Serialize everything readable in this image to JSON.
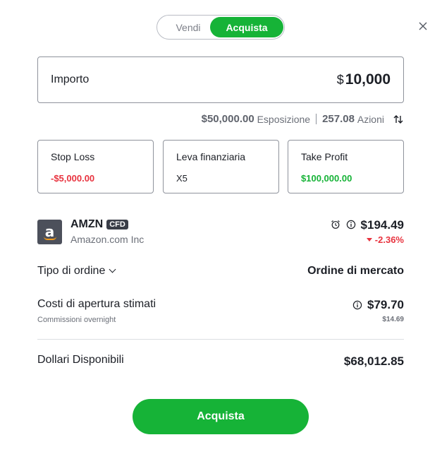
{
  "toggle": {
    "sell_label": "Vendi",
    "buy_label": "Acquista",
    "active": "buy"
  },
  "amount": {
    "label": "Importo",
    "currency": "$",
    "value": "10,000"
  },
  "exposure": {
    "value": "$50,000.00",
    "label": "Esposizione",
    "units_value": "257.08",
    "units_label": "Azioni"
  },
  "cards": {
    "stop_loss": {
      "title": "Stop Loss",
      "value": "-$5,000.00"
    },
    "leverage": {
      "title": "Leva finanziaria",
      "value": "X5"
    },
    "take_profit": {
      "title": "Take Profit",
      "value": "$100,000.00"
    }
  },
  "instrument": {
    "ticker": "AMZN",
    "badge": "CFD",
    "company": "Amazon.com Inc",
    "price": "$194.49",
    "change": "-2.36%"
  },
  "order_type": {
    "label": "Tipo di ordine",
    "value": "Ordine di mercato"
  },
  "opening_costs": {
    "label": "Costi di apertura stimati",
    "sub_label": "Commissioni overnight",
    "value": "$79.70",
    "sub_value": "$14.69"
  },
  "available": {
    "label": "Dollari Disponibili",
    "value": "$68,012.85"
  },
  "cta": {
    "label": "Acquista"
  },
  "colors": {
    "green": "#16b337",
    "red": "#e8333f",
    "text": "#1c1f26",
    "muted": "#6b6f78"
  },
  "icons": [
    "close-icon",
    "swap-icon",
    "amazon-logo-icon",
    "alarm-icon",
    "info-icon",
    "chevron-down-icon",
    "down-triangle-icon"
  ]
}
